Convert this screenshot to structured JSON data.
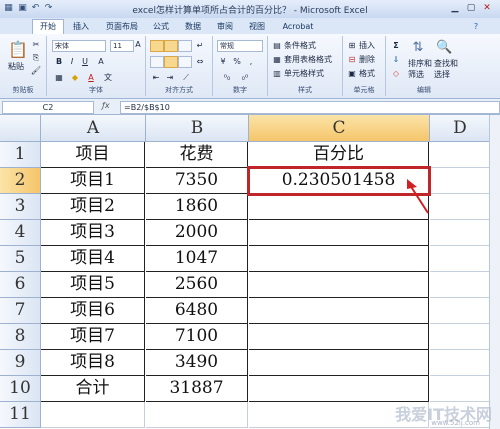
{
  "window": {
    "title": "excel怎样计算单项所占合计的百分比？ - Microsoft Excel",
    "qat": [
      "save-icon",
      "undo-icon",
      "redo-icon"
    ],
    "controls": [
      "minimize-icon",
      "maximize-icon",
      "close-icon"
    ]
  },
  "tabs": [
    {
      "label": "开始",
      "active": true
    },
    {
      "label": "插入"
    },
    {
      "label": "页面布局"
    },
    {
      "label": "公式"
    },
    {
      "label": "数据"
    },
    {
      "label": "审阅"
    },
    {
      "label": "视图"
    },
    {
      "label": "Acrobat"
    }
  ],
  "ribbon": {
    "clipboard": {
      "label": "剪贴板",
      "paste": "粘贴"
    },
    "font": {
      "label": "字体",
      "name": "宋体",
      "size": "11",
      "bold": "B",
      "italic": "I",
      "underline": "U",
      "grow": "A",
      "shrink": "A",
      "fontcolor": "A"
    },
    "alignment": {
      "label": "对齐方式"
    },
    "number": {
      "label": "数字",
      "format": "常规",
      "percent": "%",
      "comma": ",",
      "currency": "¥"
    },
    "styles": {
      "label": "样式",
      "conditional": "条件格式",
      "table": "套用表格格式",
      "cell": "单元格样式"
    },
    "cells": {
      "label": "单元格",
      "insert": "插入",
      "delete": "删除",
      "format": "格式"
    },
    "editing": {
      "label": "编辑",
      "sum": "Σ",
      "sort": "排序和",
      "sort2": "筛选",
      "find": "查找和",
      "find2": "选择"
    }
  },
  "formula_bar": {
    "name_box": "C2",
    "fx": "fx",
    "formula": "=B2/$B$10"
  },
  "sheet": {
    "columns": [
      "A",
      "B",
      "C",
      "D"
    ],
    "row_numbers": [
      "1",
      "2",
      "3",
      "4",
      "5",
      "6",
      "7",
      "8",
      "9",
      "10",
      "11"
    ],
    "rows": [
      [
        "项目",
        "花费",
        "百分比"
      ],
      [
        "项目1",
        "7350",
        "0.230501458"
      ],
      [
        "项目2",
        "1860",
        ""
      ],
      [
        "项目3",
        "2000",
        ""
      ],
      [
        "项目4",
        "1047",
        ""
      ],
      [
        "项目5",
        "2560",
        ""
      ],
      [
        "项目6",
        "6480",
        ""
      ],
      [
        "项目7",
        "7100",
        ""
      ],
      [
        "项目8",
        "3490",
        ""
      ],
      [
        "合计",
        "31887",
        ""
      ],
      [
        "",
        "",
        ""
      ]
    ],
    "selected_cell": "C2"
  },
  "watermark": {
    "text": "我爱IT技术网",
    "url": "www.52ij.com"
  },
  "colors": {
    "selection_border": "#c0252a",
    "arrow": "#d12020",
    "header_selected": "#f5c56a"
  }
}
